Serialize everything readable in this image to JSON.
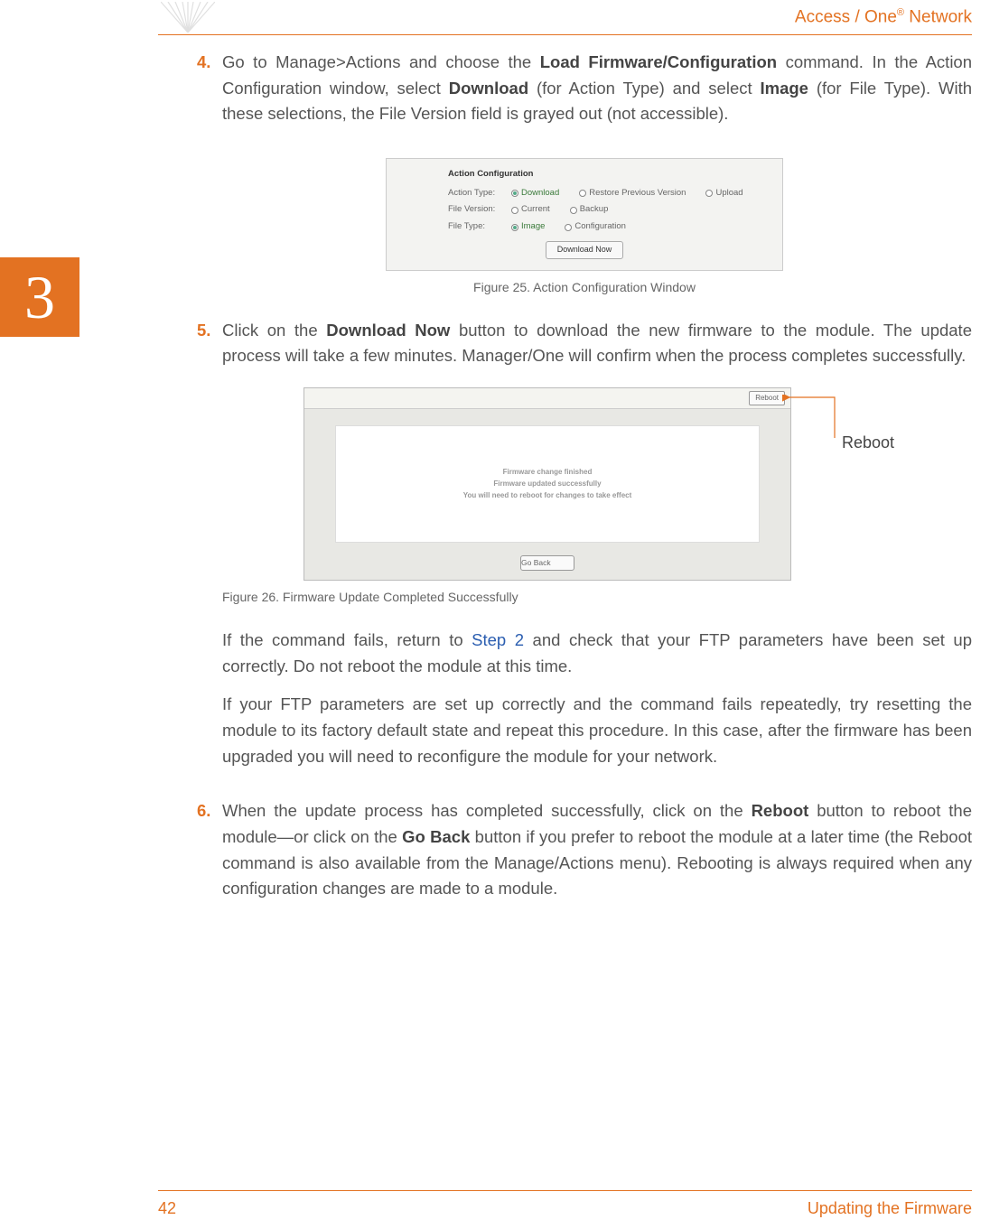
{
  "header": {
    "brand_pre": "Access / One",
    "brand_post": " Network",
    "reg": "®"
  },
  "chapter": "3",
  "steps": {
    "s4": {
      "num": "4.",
      "t1": "Go to Manage>Actions and choose the ",
      "b1": "Load Firmware/Configuration",
      "t2": " command. In the Action Configuration window, select ",
      "b2": "Download",
      "t3": " (for Action Type) and select ",
      "b3": "Image",
      "t4": " (for File Type). With these selections, the File Version field is grayed out (not accessible)."
    },
    "s5": {
      "num": "5.",
      "t1": "Click on the ",
      "b1": "Download Now",
      "t2": " button to download the new firmware to the module. The update process will take a few minutes. Manager/One will confirm when the process completes successfully.",
      "p2a": "If the command fails, return to ",
      "link": "Step 2",
      "p2b": " and check that your FTP parameters have been set up correctly. Do not reboot the module at this time.",
      "p3": "If your FTP parameters are set up correctly and the command fails repeatedly, try resetting the module to its factory default state and repeat this procedure. In this case, after the firmware has been upgraded you will need to reconfigure the module for your network."
    },
    "s6": {
      "num": "6.",
      "t1": "When the update process has completed successfully, click on the ",
      "b1": "Reboot",
      "t2": " button to reboot the module—or click on the ",
      "b2": "Go Back",
      "t3": " button if you prefer to reboot the module at a later time (the Reboot command is also available from the Manage/Actions menu). Rebooting is always required when any configuration changes are made to a module."
    }
  },
  "shot1": {
    "title": "Action Configuration",
    "r1_lbl": "Action Type:",
    "r1_o1": "Download",
    "r1_o2": "Restore Previous Version",
    "r1_o3": "Upload",
    "r2_lbl": "File Version:",
    "r2_o1": "Current",
    "r2_o2": "Backup",
    "r3_lbl": "File Type:",
    "r3_o1": "Image",
    "r3_o2": "Configuration",
    "btn": "Download Now"
  },
  "caption1": "Figure 25. Action Configuration Window",
  "shot2": {
    "reboot": "Reboot",
    "msg1": "Firmware change finished",
    "msg2": "Firmware updated successfully",
    "msg3": "You will need to reboot for changes to take effect",
    "goback": "Go Back"
  },
  "callout": "Reboot",
  "caption2": "Figure 26. Firmware Update Completed Successfully",
  "footer": {
    "page": "42",
    "section": "Updating the Firmware"
  }
}
